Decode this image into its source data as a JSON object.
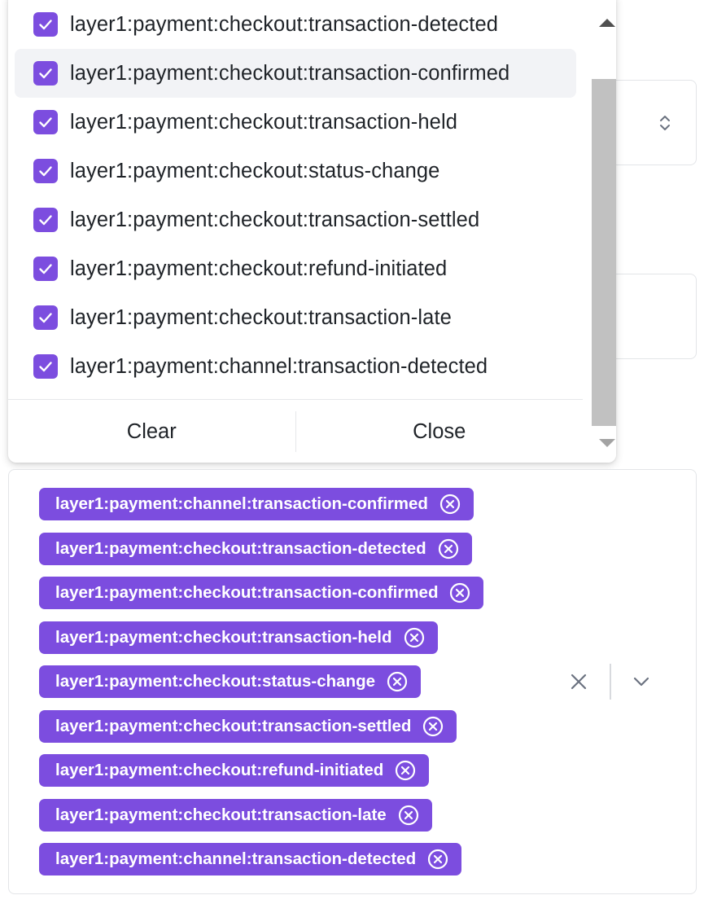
{
  "dropdown": {
    "options": [
      {
        "label": "layer1:payment:checkout:transaction-detected",
        "checked": true
      },
      {
        "label": "layer1:payment:checkout:transaction-confirmed",
        "checked": true
      },
      {
        "label": "layer1:payment:checkout:transaction-held",
        "checked": true
      },
      {
        "label": "layer1:payment:checkout:status-change",
        "checked": true
      },
      {
        "label": "layer1:payment:checkout:transaction-settled",
        "checked": true
      },
      {
        "label": "layer1:payment:checkout:refund-initiated",
        "checked": true
      },
      {
        "label": "layer1:payment:checkout:transaction-late",
        "checked": true
      },
      {
        "label": "layer1:payment:channel:transaction-detected",
        "checked": true
      }
    ],
    "clear_label": "Clear",
    "close_label": "Close"
  },
  "selected_chips": [
    "layer1:payment:channel:transaction-confirmed",
    "layer1:payment:checkout:transaction-detected",
    "layer1:payment:checkout:transaction-confirmed",
    "layer1:payment:checkout:transaction-held",
    "layer1:payment:checkout:status-change",
    "layer1:payment:checkout:transaction-settled",
    "layer1:payment:checkout:refund-initiated",
    "layer1:payment:checkout:transaction-late",
    "layer1:payment:channel:transaction-detected"
  ],
  "icons": {
    "checkbox": "checkmark-icon",
    "chip_remove": "circle-x-icon",
    "clear_all": "close-icon",
    "open_menu": "chevron-down-icon",
    "select_updown": "chevron-up-down-icon",
    "scroll_up": "scroll-up-arrow-icon",
    "scroll_down": "scroll-down-arrow-icon"
  },
  "colors": {
    "accent": "#7c4ddf",
    "chip_text": "#ffffff",
    "text": "#1f2328",
    "hover_bg": "#f2f3f6"
  }
}
